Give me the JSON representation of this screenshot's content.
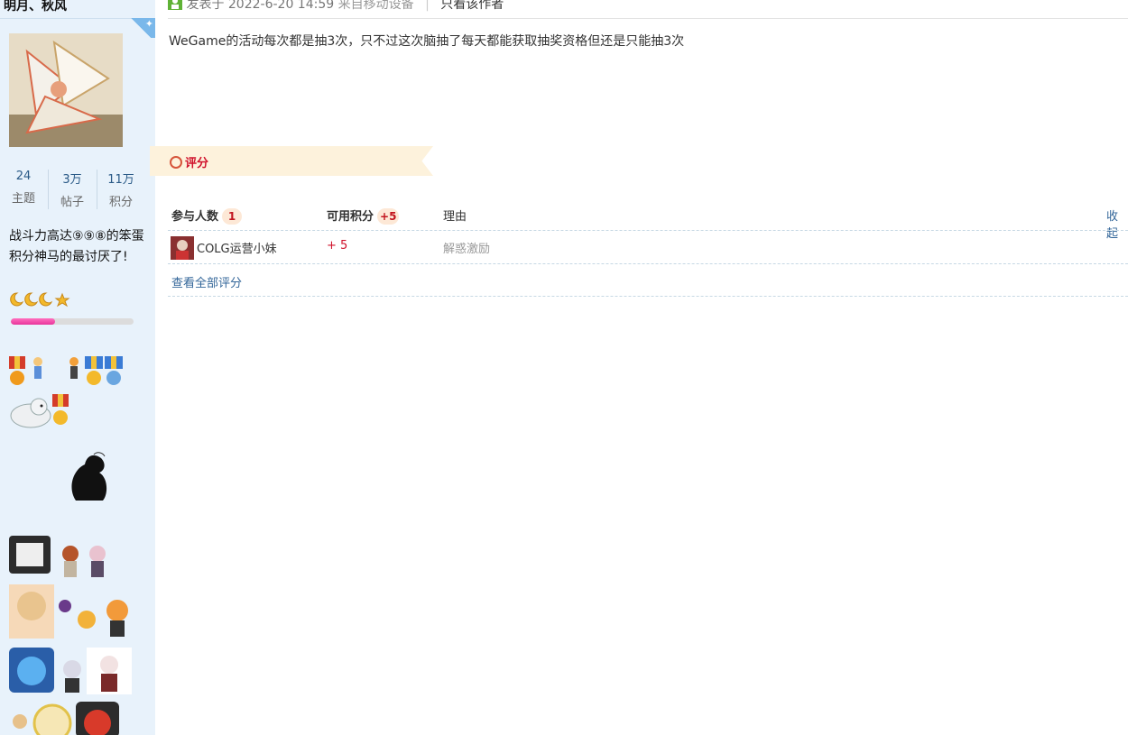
{
  "sidebar": {
    "username": "明月、秋风",
    "stats": [
      {
        "value": "24",
        "label": "主题"
      },
      {
        "value": "3万",
        "label": "帖子"
      },
      {
        "value": "11万",
        "label": "积分"
      }
    ],
    "user_title": "战斗力高达⑨⑨⑧的笨蛋积分神马的最讨厌了!",
    "level_icons": "🌙🌙🌙⭐",
    "level_progress_percent": 36
  },
  "post": {
    "meta_prefix": "发表于 2022-6-20 14:59",
    "meta_from": "来自移动设备",
    "only_author": "只看该作者",
    "body": "WeGame的活动每次都是抽3次，只不过这次脑抽了每天都能获取抽奖资格但还是只能抽3次"
  },
  "rating": {
    "title": "评分",
    "col_participants": "参与人数",
    "participants_count": "1",
    "col_points": "可用积分",
    "points_total": "+5",
    "col_reason": "理由",
    "collapse": "收起",
    "rows": [
      {
        "name": "COLG运营小妹",
        "score": "+ 5",
        "reason": "解惑激励"
      }
    ],
    "view_all": "查看全部评分"
  },
  "colors": {
    "sidebar_bg": "#e8f2fb",
    "accent_red": "#d0112b",
    "link_blue": "#336699"
  }
}
